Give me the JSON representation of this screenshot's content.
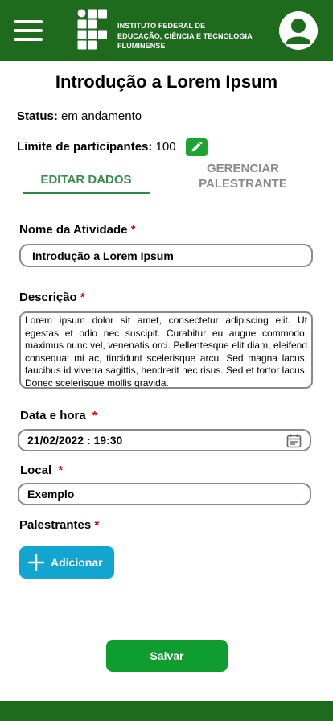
{
  "header": {
    "logo_lines": [
      "INSTITUTO FEDERAL DE",
      "EDUCAÇÃO, CIÊNCIA E TECNOLOGIA",
      "FLUMINENSE"
    ],
    "color": "#1e6b1e"
  },
  "page": {
    "title": "Introdução a Lorem Ipsum"
  },
  "status": {
    "label": "Status:",
    "value": "em andamento"
  },
  "limit": {
    "label": "Limite de participantes:",
    "value": "100"
  },
  "tabs": [
    {
      "label": "EDITAR DADOS",
      "active": true
    },
    {
      "label_lines": [
        "GERENCIAR",
        "PALESTRANTE"
      ],
      "active": false
    }
  ],
  "form": {
    "required_mark": "*",
    "name": {
      "label": "Nome da Atividade",
      "value": "Introdução a Lorem Ipsum"
    },
    "description": {
      "label": "Descrição",
      "value": "Lorem ipsum dolor sit amet, consectetur adipiscing elit. Ut egestas et odio nec suscipit. Curabitur eu augue commodo, maximus nunc vel, venenatis orci. Pellentesque elit diam, eleifend consequat mi ac, tincidunt scelerisque arcu. Sed magna lacus, faucibus id viverra sagittis, hendrerit nec risus. Sed et tortor lacus. Donec scelerisque mollis gravida."
    },
    "datetime": {
      "label": "Data e hora",
      "value": "21/02/2022 : 19:30"
    },
    "location": {
      "label": "Local",
      "value": "Exemplo"
    },
    "speakers": {
      "label": "Palestrantes",
      "add_label": "Adicionar"
    }
  },
  "actions": {
    "save_label": "Salvar"
  },
  "icons": [
    "menu-icon",
    "ifet-logo-icon",
    "user-avatar-icon",
    "pencil-icon",
    "calendar-icon",
    "plus-icon"
  ],
  "colors": {
    "primary_green": "#1e6b1e",
    "button_green": "#0f9d2f",
    "add_blue": "#11a5cf",
    "required_red": "#d30000"
  }
}
